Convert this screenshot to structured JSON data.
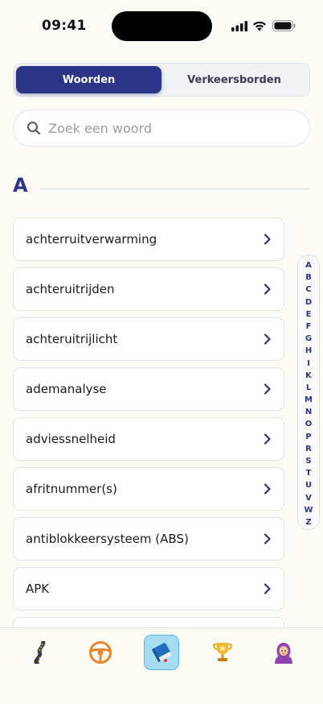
{
  "status_bar": {
    "time": "09:41"
  },
  "segmented": {
    "tabs": [
      {
        "label": "Woorden",
        "active": true
      },
      {
        "label": "Verkeersborden",
        "active": false
      }
    ]
  },
  "search": {
    "placeholder": "Zoek een woord",
    "value": ""
  },
  "section": {
    "letter": "A"
  },
  "list": {
    "items": [
      "achterruitverwarming",
      "achteruitrijden",
      "achteruitrijlicht",
      "ademanalyse",
      "adviessnelheid",
      "afritnummer(s)",
      "antiblokkeersysteem (ABS)",
      "APK"
    ]
  },
  "alpha_index": [
    "A",
    "B",
    "C",
    "D",
    "E",
    "F",
    "G",
    "H",
    "I",
    "K",
    "L",
    "M",
    "N",
    "O",
    "P",
    "R",
    "S",
    "T",
    "U",
    "V",
    "W",
    "Z"
  ],
  "tab_bar": {
    "tabs": [
      {
        "icon": "road-icon",
        "active": false
      },
      {
        "icon": "steering-wheel-icon",
        "active": false
      },
      {
        "icon": "book-icon",
        "active": true
      },
      {
        "icon": "trophy-icon",
        "active": false
      },
      {
        "icon": "avatar-icon",
        "active": false
      }
    ]
  },
  "colors": {
    "accent": "#2b3486",
    "background": "#fcfbf6",
    "active_tab": "#a6dcf2"
  }
}
